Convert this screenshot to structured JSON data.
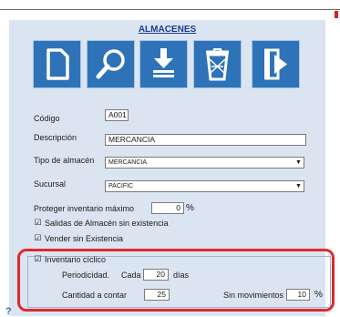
{
  "window": {
    "title": "ALMACENES"
  },
  "toolbar": {
    "buttons": [
      "new-document-icon",
      "search-icon",
      "download-icon",
      "recycle-bin-icon",
      "exit-icon"
    ]
  },
  "form": {
    "codigo": {
      "label": "Código",
      "value": "A001"
    },
    "descripcion": {
      "label": "Descripción",
      "value": "MERCANCIA"
    },
    "tipo_almacen": {
      "label": "Tipo de almacén",
      "value": "MERCANCIA"
    },
    "sucursal": {
      "label": "Sucursal",
      "value": "PACIFIC"
    },
    "proteger": {
      "label": "Proteger inventario máximo",
      "value": "0",
      "unit": "%"
    },
    "salidas": {
      "label": "Salidas de Almacén sin existencia",
      "checked": true
    },
    "vender": {
      "label": "Vender sin Existencia",
      "checked": true
    }
  },
  "ciclico": {
    "label": "Inventario cíclico",
    "checked": true,
    "periodicidad_label": "Periodicidad.",
    "cada_label": "Cada",
    "cada_value": "20",
    "dias_label": "días",
    "cantidad_label": "Cantidad a contar",
    "cantidad_value": "25",
    "sin_mov_label": "Sin movimientos",
    "sin_mov_value": "10",
    "sin_mov_unit": "%"
  },
  "check_glyph": "☑",
  "colors": {
    "panel": "#dbe5f1",
    "toolbar_button": "#2e73b8",
    "title": "#1f3a93",
    "highlight": "#e0282e"
  }
}
